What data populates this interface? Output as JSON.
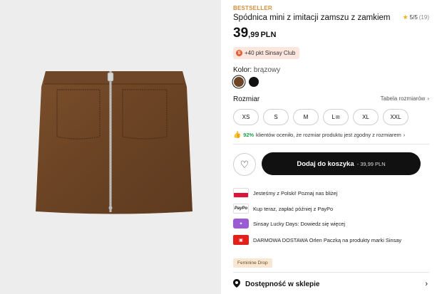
{
  "product": {
    "badge": "BESTSELLER",
    "title": "Spódnica mini z imitacji zamszu z zamkiem",
    "rating": "5/5",
    "rating_count": "(19)",
    "price_main": "39",
    "price_decimal": ",99",
    "currency": "PLN",
    "club_label": "+40 pkt Sinsay Club"
  },
  "colors": {
    "label": "Kolor:",
    "selected": "brązowy",
    "swatches": [
      {
        "name": "brązowy",
        "hex": "#6d4526"
      },
      {
        "name": "czarny",
        "hex": "#111111"
      }
    ]
  },
  "sizes": {
    "label": "Rozmiar",
    "chart_link": "Tabela rozmiarów",
    "options": [
      "XS",
      "S",
      "M",
      "L",
      "XL",
      "XXL"
    ],
    "fit_percent": "92%",
    "fit_text": "klientów oceniło, że rozmiar produktu jest zgodny z rozmiarem"
  },
  "cart": {
    "button_label": "Dodaj do koszyka",
    "button_price": "- 39,99 PLN"
  },
  "info": [
    {
      "icon": "poland-flag-icon",
      "text": "Jesteśmy z Polski! Poznaj nas bliżej"
    },
    {
      "icon": "paypo-logo-icon",
      "icon_text": "PayPo",
      "text": "Kup teraz, zapłać później z PayPo"
    },
    {
      "icon": "lucky-days-icon",
      "text": "Sinsay Lucky Days: Dowiedz się więcej"
    },
    {
      "icon": "orlen-paczka-icon",
      "text": "DARMOWA DOSTAWA Orlen Paczką na produkty marki Sinsay"
    }
  ],
  "tag": "Feminine Drop",
  "store": {
    "label": "Dostępność w sklepie"
  },
  "accent_colors": {
    "badge": "#d48e3c",
    "club_bg": "#fde6dd",
    "fit_green": "#1b9e4b",
    "cart_bg": "#111111"
  }
}
